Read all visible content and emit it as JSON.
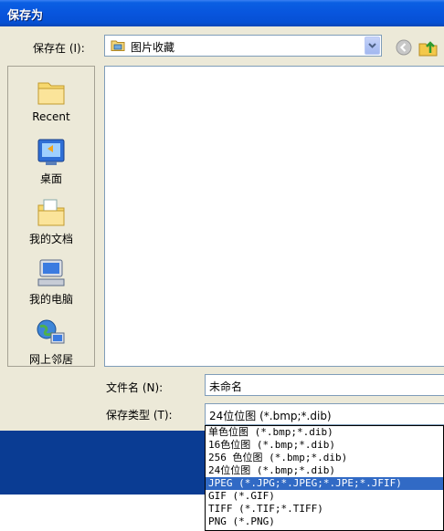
{
  "window": {
    "title": "保存为"
  },
  "save_in": {
    "label": "保存在 (I):",
    "value": "图片收藏"
  },
  "places": [
    {
      "label": "Recent",
      "icon": "recent-folder-icon"
    },
    {
      "label": "桌面",
      "icon": "desktop-icon"
    },
    {
      "label": "我的文档",
      "icon": "my-documents-icon"
    },
    {
      "label": "我的电脑",
      "icon": "my-computer-icon"
    },
    {
      "label": "网上邻居",
      "icon": "network-places-icon"
    }
  ],
  "filename": {
    "label": "文件名 (N):",
    "value": "未命名"
  },
  "filetype": {
    "label": "保存类型 (T):",
    "value": "24位位图 (*.bmp;*.dib)",
    "options": [
      "单色位图 (*.bmp;*.dib)",
      "16色位图 (*.bmp;*.dib)",
      "256 色位图 (*.bmp;*.dib)",
      "24位位图 (*.bmp;*.dib)",
      "JPEG (*.JPG;*.JPEG;*.JPE;*.JFIF)",
      "GIF (*.GIF)",
      "TIFF (*.TIF;*.TIFF)",
      "PNG (*.PNG)"
    ],
    "selected_index": 4
  },
  "colors": {
    "titlebar": "#0855dd",
    "dialog": "#ece9d8",
    "selection": "#316ac5",
    "background": "#0a3c93"
  }
}
